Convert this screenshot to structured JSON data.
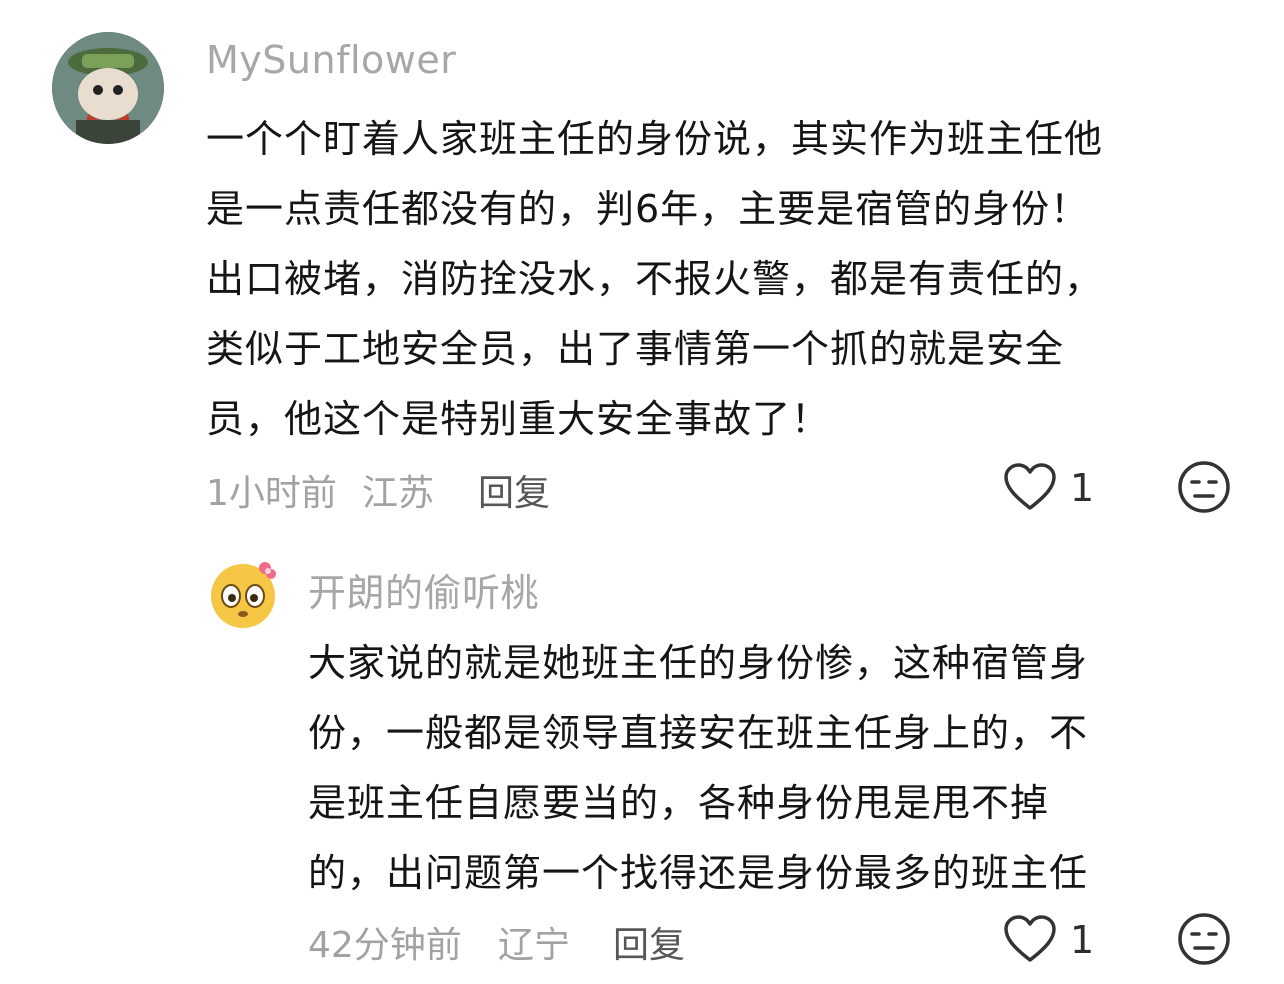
{
  "comments": [
    {
      "username": "MySunflower",
      "lines": [
        "一个个盯着人家班主任的身份说，其实作为班主任他",
        "是一点责任都没有的，判6年，主要是宿管的身份！",
        "出口被堵，消防拴没水，不报火警，都是有责任的，",
        "类似于工地安全员，出了事情第一个抓的就是安全",
        "员，他这个是特别重大安全事故了！"
      ],
      "time": "1小时前",
      "location": "江苏",
      "reply_label": "回复",
      "likes": "1"
    },
    {
      "username": "开朗的偷听桃",
      "lines": [
        "大家说的就是她班主任的身份惨，这种宿管身",
        "份，一般都是领导直接安在班主任身上的，不",
        "是班主任自愿要当的，各种身份甩是甩不掉",
        "的，出问题第一个找得还是身份最多的班主任"
      ],
      "time": "42分钟前",
      "location": "辽宁",
      "reply_label": "回复",
      "likes": "1"
    }
  ],
  "icons": {
    "like": "heart-outline-icon",
    "dislike": "unamused-face-icon"
  },
  "colors": {
    "username": "#a7a7a7",
    "text": "#151515",
    "meta": "#a2a2a2",
    "icon": "#333333"
  }
}
